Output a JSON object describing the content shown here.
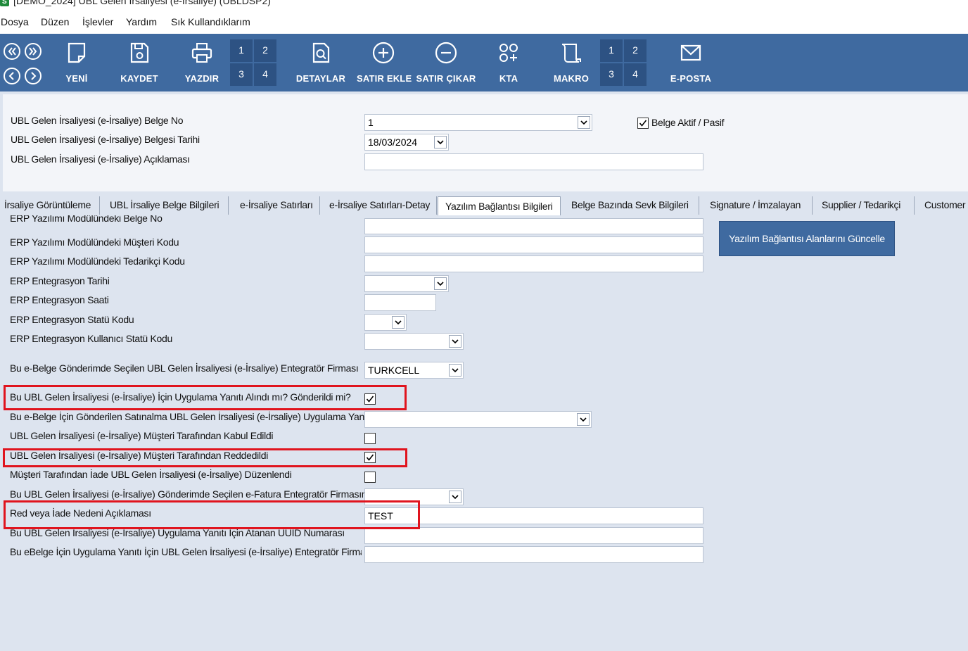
{
  "window": {
    "title": "[DEMO_2024] UBL Gelen İrsaliyesi (e-İrsaliye) (UBLDSP2)"
  },
  "menu": [
    "Dosya",
    "Düzen",
    "İşlevler",
    "Yardım",
    "Sık Kullandıklarım"
  ],
  "toolbar": {
    "new_label": "YENİ",
    "save_label": "KAYDET",
    "print_label": "YAZDIR",
    "details_label": "DETAYLAR",
    "add_row_label": "SATIR EKLE",
    "remove_row_label": "SATIR ÇIKAR",
    "kta_label": "KTA",
    "macro_label": "MAKRO",
    "email_label": "E-POSTA",
    "page_numbers": [
      "1",
      "2",
      "3",
      "4"
    ]
  },
  "header": {
    "doc_no_label": "UBL Gelen İrsaliyesi (e-İrsaliye) Belge No",
    "doc_no_value": "1",
    "doc_date_label": "UBL Gelen İrsaliyesi (e-İrsaliye) Belgesi Tarihi",
    "doc_date_value": "18/03/2024",
    "doc_desc_label": "UBL Gelen İrsaliyesi (e-İrsaliye) Açıklaması",
    "doc_desc_value": "",
    "active_label": "Belge Aktif / Pasif",
    "active_checked": true
  },
  "tabs": [
    {
      "label": "İrsaliye Görüntüleme"
    },
    {
      "label": "UBL İrsaliye Belge Bilgileri"
    },
    {
      "label": "e-İrsaliye Satırları"
    },
    {
      "label": "e-İrsaliye Satırları-Detay"
    },
    {
      "label": "Yazılım Bağlantısı Bilgileri",
      "active": true
    },
    {
      "label": "Belge Bazında Sevk Bilgileri"
    },
    {
      "label": "Signature / İmzalayan"
    },
    {
      "label": "Supplier / Tedarikçi"
    },
    {
      "label": "Customer / Alıcı"
    }
  ],
  "content": {
    "update_button": "Yazılım Bağlantısı Alanlarını Güncelle",
    "fields": [
      {
        "label": "ERP Yazılımı Modülündeki Belge No",
        "value": ""
      },
      {
        "label": "ERP Yazılımı Modülündeki Müşteri Kodu",
        "value": ""
      },
      {
        "label": "ERP Yazılımı Modülündeki Tedarikçi Kodu",
        "value": ""
      },
      {
        "label": "ERP Entegrasyon Tarihi",
        "value": ""
      },
      {
        "label": "ERP Entegrasyon Saati",
        "value": ""
      },
      {
        "label": "ERP Entegrasyon Statü Kodu",
        "value": ""
      },
      {
        "label": "ERP Entegrasyon Kullanıcı Statü Kodu",
        "value": ""
      },
      {
        "label": "Bu e-Belge Gönderimde Seçilen UBL Gelen İrsaliyesi (e-İrsaliye) Entegratör Firması",
        "value": "TURKCELL"
      },
      {
        "label": "Bu UBL Gelen İrsaliyesi (e-İrsaliye) İçin Uygulama Yanıtı Alındı mı? Gönderildi mi?",
        "checked": true
      },
      {
        "label": "Bu e-Belge İçin Gönderilen Satınalma UBL Gelen İrsaliyesi (e-İrsaliye) Uygulama Yanıt",
        "value": ""
      },
      {
        "label": "UBL Gelen İrsaliyesi (e-İrsaliye) Müşteri Tarafından Kabul Edildi",
        "checked": false
      },
      {
        "label": "UBL Gelen İrsaliyesi (e-İrsaliye) Müşteri Tarafından Reddedildi",
        "checked": true
      },
      {
        "label": "Müşteri Tarafından İade UBL Gelen İrsaliyesi (e-İrsaliye) Düzenlendi",
        "checked": false
      },
      {
        "label": "Bu UBL Gelen İrsaliyesi (e-İrsaliye) Gönderimde Seçilen e-Fatura Entegratör Firmasının",
        "value": ""
      },
      {
        "label": "Red veya İade Nedeni Açıklaması",
        "value": "TEST"
      },
      {
        "label": "Bu UBL Gelen İrsaliyesi (e-İrsaliye) Uygulama Yanıtı İçin Atanan UUID Numarası",
        "value": ""
      },
      {
        "label": "Bu eBelge İçin Uygulama Yanıtı İçin UBL Gelen İrsaliyesi (e-İrsaliye) Entegratör Firması",
        "value": ""
      }
    ]
  },
  "colors": {
    "toolbar": "#3f6aa0",
    "highlight": "#e0141e",
    "content_bg": "#dde4ef"
  }
}
